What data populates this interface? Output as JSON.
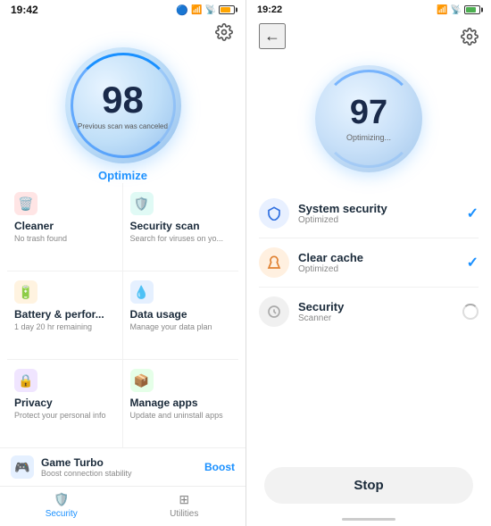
{
  "left": {
    "time": "19:42",
    "score": "98",
    "scan_cancelled": "Previous scan was canceled",
    "optimize_label": "Optimize",
    "grid": [
      {
        "id": "cleaner",
        "title": "Cleaner",
        "sub": "No trash found",
        "icon": "🗑️",
        "color": "icon-red"
      },
      {
        "id": "security-scan",
        "title": "Security scan",
        "sub": "Search for viruses on yo...",
        "icon": "🛡️",
        "color": "icon-teal"
      },
      {
        "id": "battery",
        "title": "Battery & perfor...",
        "sub": "1 day 20 hr remaining",
        "icon": "🔋",
        "color": "icon-orange"
      },
      {
        "id": "data-usage",
        "title": "Data usage",
        "sub": "Manage your data plan",
        "icon": "💧",
        "color": "icon-blue"
      },
      {
        "id": "privacy",
        "title": "Privacy",
        "sub": "Protect your personal info",
        "icon": "👁️",
        "color": "icon-purple"
      },
      {
        "id": "manage-apps",
        "title": "Manage apps",
        "sub": "Update and uninstall apps",
        "icon": "📦",
        "color": "icon-green"
      }
    ],
    "game_turbo": {
      "title": "Game Turbo",
      "sub": "Boost connection stability",
      "boost_label": "Boost"
    },
    "nav": [
      {
        "id": "security",
        "label": "Security",
        "icon": "🛡️",
        "active": true
      },
      {
        "id": "utilities",
        "label": "Utilities",
        "icon": "⚙️",
        "active": false
      }
    ]
  },
  "right": {
    "time": "19:22",
    "score": "97",
    "optimizing": "Optimizing...",
    "scan_items": [
      {
        "id": "system-security",
        "title": "System security",
        "sub": "Optimized",
        "icon": "🔼",
        "color": "si-blue",
        "status": "check"
      },
      {
        "id": "clear-cache",
        "title": "Clear cache",
        "sub": "Optimized",
        "icon": "🔸",
        "color": "si-orange",
        "status": "check"
      },
      {
        "id": "security-scanner",
        "title": "Security",
        "sub": "Scanner",
        "icon": "⬜",
        "color": "si-gray",
        "status": "spinner"
      }
    ],
    "stop_label": "Stop"
  }
}
